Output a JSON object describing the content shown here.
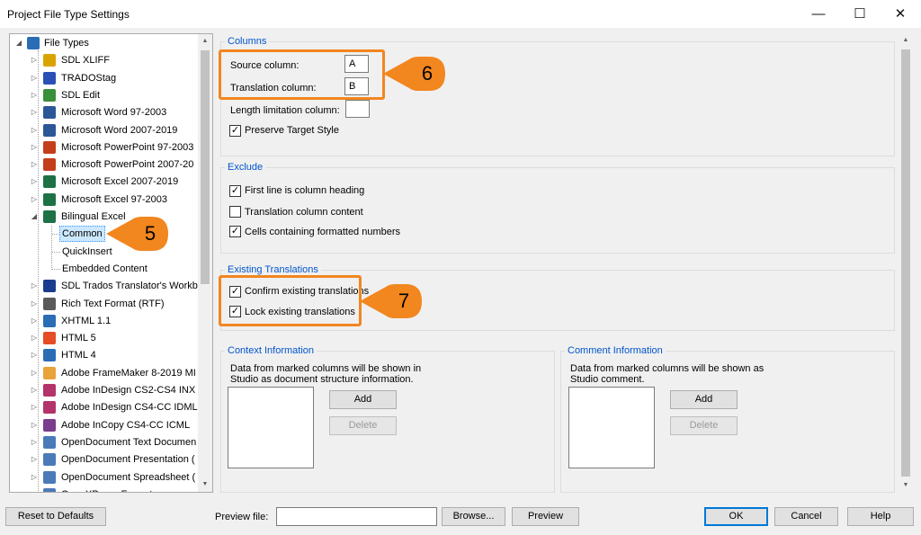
{
  "window": {
    "title": "Project File Type Settings",
    "minimize_glyph": "—",
    "maximize_glyph": "☐",
    "close_glyph": "✕"
  },
  "tree": {
    "items": [
      {
        "label": "File Types",
        "expander": "◢",
        "icon": "gear-folder-icon",
        "color": "#2a6db5"
      },
      {
        "label": "SDL XLIFF",
        "expander": "▷",
        "icon": "xliff-icon",
        "color": "#d9a400"
      },
      {
        "label": "TRADOStag",
        "expander": "▷",
        "icon": "tradostag-icon",
        "color": "#2a50b5"
      },
      {
        "label": "SDL Edit",
        "expander": "▷",
        "icon": "sdl-edit-icon",
        "color": "#3a8f3a"
      },
      {
        "label": "Microsoft Word 97-2003",
        "expander": "▷",
        "icon": "word-97-icon",
        "color": "#2b5797"
      },
      {
        "label": "Microsoft Word 2007-2019",
        "expander": "▷",
        "icon": "word-2007-icon",
        "color": "#2b5797"
      },
      {
        "label": "Microsoft PowerPoint 97-2003",
        "expander": "▷",
        "icon": "powerpoint-97-icon",
        "color": "#c43e1c"
      },
      {
        "label": "Microsoft PowerPoint 2007-20",
        "expander": "▷",
        "icon": "powerpoint-2007-icon",
        "color": "#c43e1c"
      },
      {
        "label": "Microsoft Excel 2007-2019",
        "expander": "▷",
        "icon": "excel-2007-icon",
        "color": "#1e7145"
      },
      {
        "label": "Microsoft Excel 97-2003",
        "expander": "▷",
        "icon": "excel-97-icon",
        "color": "#1e7145"
      },
      {
        "label": "Bilingual Excel",
        "expander": "◢",
        "icon": "bilingual-excel-icon",
        "color": "#1e7145"
      },
      {
        "label": "Common",
        "child": true,
        "selected": true
      },
      {
        "label": "QuickInsert",
        "child": true
      },
      {
        "label": "Embedded Content",
        "child": true
      },
      {
        "label": "SDL Trados Translator's Workb",
        "expander": "▷",
        "icon": "trados-workbench-icon",
        "color": "#1a3c8c"
      },
      {
        "label": "Rich Text Format (RTF)",
        "expander": "▷",
        "icon": "rtf-icon",
        "color": "#5a5a5a"
      },
      {
        "label": "XHTML 1.1",
        "expander": "▷",
        "icon": "xhtml-icon",
        "color": "#2a6db5"
      },
      {
        "label": "HTML 5",
        "expander": "▷",
        "icon": "html5-icon",
        "color": "#e44d26"
      },
      {
        "label": "HTML 4",
        "expander": "▷",
        "icon": "html4-icon",
        "color": "#2a6db5"
      },
      {
        "label": "Adobe FrameMaker 8-2019 MI",
        "expander": "▷",
        "icon": "framemaker-icon",
        "color": "#e8a33b"
      },
      {
        "label": "Adobe InDesign CS2-CS4 INX",
        "expander": "▷",
        "icon": "indesign-inx-icon",
        "color": "#b3336b"
      },
      {
        "label": "Adobe InDesign CS4-CC IDML",
        "expander": "▷",
        "icon": "indesign-idml-icon",
        "color": "#b3336b"
      },
      {
        "label": "Adobe InCopy CS4-CC ICML",
        "expander": "▷",
        "icon": "incopy-icon",
        "color": "#7a3c8c"
      },
      {
        "label": "OpenDocument Text Documen",
        "expander": "▷",
        "icon": "odt-icon",
        "color": "#4a7ab8"
      },
      {
        "label": "OpenDocument Presentation (",
        "expander": "▷",
        "icon": "odp-icon",
        "color": "#4a7ab8"
      },
      {
        "label": "OpenDocument Spreadsheet (",
        "expander": "▷",
        "icon": "ods-icon",
        "color": "#4a7ab8"
      },
      {
        "label": "OpenXPaper Format",
        "expander": "▷",
        "icon": "openxps-icon",
        "color": "#4a7ab8"
      }
    ]
  },
  "columns": {
    "title": "Columns",
    "source_label": "Source column:",
    "source_value": "A",
    "translation_label": "Translation column:",
    "translation_value": "B",
    "length_label": "Length limitation column:",
    "length_value": "",
    "preserve_label": "Preserve Target Style",
    "preserve_checked": true
  },
  "exclude": {
    "title": "Exclude",
    "items": [
      {
        "label": "First line is column heading",
        "checked": true
      },
      {
        "label": "Translation column content",
        "checked": false
      },
      {
        "label": "Cells containing formatted numbers",
        "checked": true
      }
    ]
  },
  "existing": {
    "title": "Existing Translations",
    "items": [
      {
        "label": "Confirm existing translations",
        "checked": true
      },
      {
        "label": "Lock existing translations",
        "checked": true
      }
    ]
  },
  "context": {
    "title": "Context Information",
    "desc1": "Data from marked columns will be shown in",
    "desc2": "Studio as document structure information.",
    "add": "Add",
    "delete": "Delete"
  },
  "comment": {
    "title": "Comment Information",
    "desc1": "Data from marked columns will be shown as",
    "desc2": "Studio comment.",
    "add": "Add",
    "delete": "Delete"
  },
  "callouts": [
    "5",
    "6",
    "7"
  ],
  "footer": {
    "reset": "Reset to Defaults",
    "preview_file_label": "Preview file:",
    "preview_file_value": "",
    "browse": "Browse...",
    "preview": "Preview",
    "ok": "OK",
    "cancel": "Cancel",
    "help": "Help"
  },
  "check_glyph": "✓",
  "colors": {
    "accent": "#0078d7",
    "highlight": "#f2861f",
    "group_title": "#0055cc"
  }
}
